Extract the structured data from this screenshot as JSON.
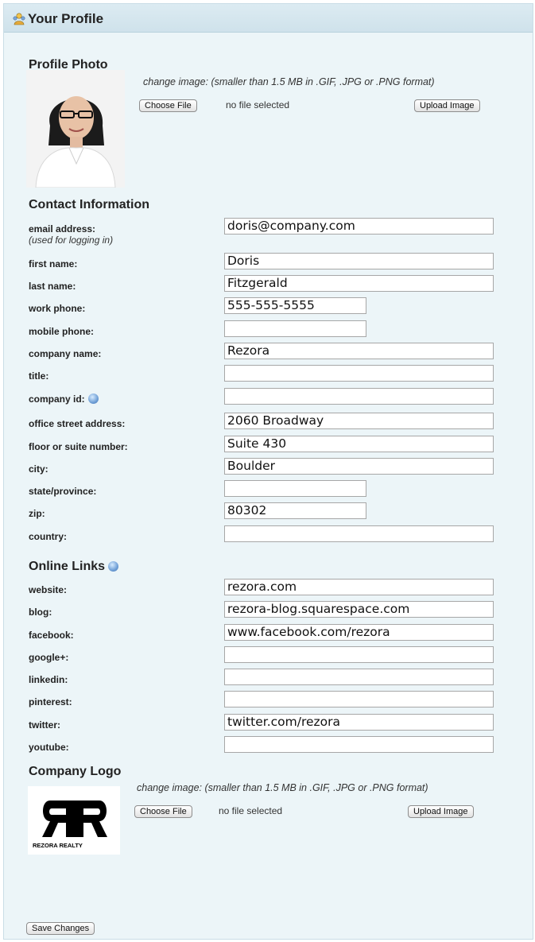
{
  "header": {
    "title": "Your Profile",
    "icon": "user-group-icon"
  },
  "profile_photo": {
    "title": "Profile Photo",
    "note": "change image: (smaller than 1.5 MB in .GIF, .JPG or .PNG format)",
    "choose_label": "Choose File",
    "file_status": "no file selected",
    "upload_label": "Upload Image"
  },
  "contact": {
    "title": "Contact Information",
    "email": {
      "label": "email address:",
      "sub": "(used for logging in)",
      "value": "doris@company.com"
    },
    "first_name": {
      "label": "first name:",
      "value": "Doris"
    },
    "last_name": {
      "label": "last name:",
      "value": "Fitzgerald"
    },
    "work_phone": {
      "label": "work phone:",
      "value": "555-555-5555"
    },
    "mobile_phone": {
      "label": "mobile phone:",
      "value": ""
    },
    "company_name": {
      "label": "company name:",
      "value": "Rezora"
    },
    "title_field": {
      "label": "title:",
      "value": ""
    },
    "company_id": {
      "label": "company id:",
      "value": ""
    },
    "street": {
      "label": "office street address:",
      "value": "2060 Broadway"
    },
    "suite": {
      "label": "floor or suite number:",
      "value": "Suite 430"
    },
    "city": {
      "label": "city:",
      "value": "Boulder"
    },
    "state": {
      "label": "state/province:",
      "value": ""
    },
    "zip": {
      "label": "zip:",
      "value": "80302"
    },
    "country": {
      "label": "country:",
      "value": ""
    }
  },
  "links": {
    "title": "Online Links",
    "website": {
      "label": "website:",
      "value": "rezora.com"
    },
    "blog": {
      "label": "blog:",
      "value": "rezora-blog.squarespace.com"
    },
    "facebook": {
      "label": "facebook:",
      "value": "www.facebook.com/rezora"
    },
    "googleplus": {
      "label": "google+:",
      "value": ""
    },
    "linkedin": {
      "label": "linkedin:",
      "value": ""
    },
    "pinterest": {
      "label": "pinterest:",
      "value": ""
    },
    "twitter": {
      "label": "twitter:",
      "value": "twitter.com/rezora"
    },
    "youtube": {
      "label": "youtube:",
      "value": ""
    }
  },
  "logo": {
    "title": "Company Logo",
    "note": "change image: (smaller than 1.5 MB in .GIF, .JPG or .PNG format)",
    "choose_label": "Choose File",
    "file_status": "no file selected",
    "upload_label": "Upload Image",
    "logo_text": "REZORA REALTY"
  },
  "save_label": "Save Changes",
  "colors": {
    "panel_bg": "#ecf5f8",
    "header_bg": "#d4e6ee",
    "border": "#c9dde6"
  }
}
